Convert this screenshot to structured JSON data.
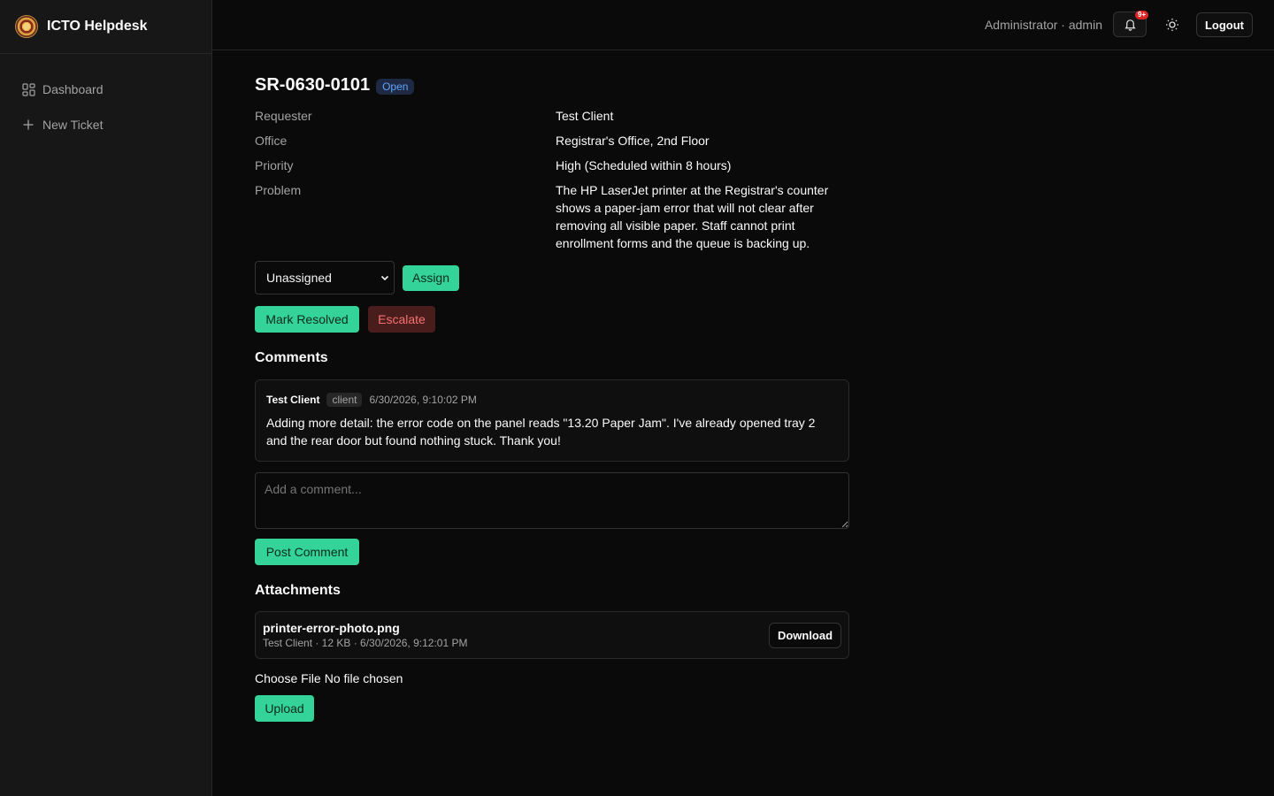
{
  "app": {
    "title": "ICTO Helpdesk"
  },
  "sidebar": {
    "items": [
      {
        "label": "Dashboard",
        "icon": "grid-icon"
      },
      {
        "label": "New Ticket",
        "icon": "plus-icon"
      }
    ]
  },
  "topbar": {
    "user_label": "Administrator · admin",
    "notification_badge": "9+",
    "logout_label": "Logout"
  },
  "ticket": {
    "id": "SR-0630-0101",
    "status": "Open",
    "details": [
      {
        "label": "Requester",
        "value": "Test Client"
      },
      {
        "label": "Office",
        "value": "Registrar's Office, 2nd Floor"
      },
      {
        "label": "Priority",
        "value": "High (Scheduled within 8 hours)"
      },
      {
        "label": "Problem",
        "value": "The HP LaserJet printer at the Registrar's counter shows a paper-jam error that will not clear after removing all visible paper. Staff cannot print enrollment forms and the queue is backing up."
      }
    ],
    "assignee_select": "Unassigned",
    "assign_label": "Assign",
    "resolve_label": "Mark Resolved",
    "escalate_label": "Escalate"
  },
  "comments": {
    "title": "Comments",
    "items": [
      {
        "author": "Test Client",
        "role": "client",
        "time": "6/30/2026, 9:10:02 PM",
        "body": "Adding more detail: the error code on the panel reads \"13.20 Paper Jam\". I've already opened tray 2 and the rear door but found nothing stuck. Thank you!"
      }
    ],
    "input_placeholder": "Add a comment...",
    "post_label": "Post Comment"
  },
  "attachments": {
    "title": "Attachments",
    "items": [
      {
        "name": "printer-error-photo.png",
        "meta": "Test Client · 12 KB · 6/30/2026, 9:12:01 PM",
        "download_label": "Download"
      }
    ],
    "choose_file_label": "Choose File",
    "no_file_label": "No file chosen",
    "upload_label": "Upload"
  },
  "colors": {
    "accent": "#34d399",
    "danger": "#f87171",
    "status_open": "#60a5fa"
  }
}
